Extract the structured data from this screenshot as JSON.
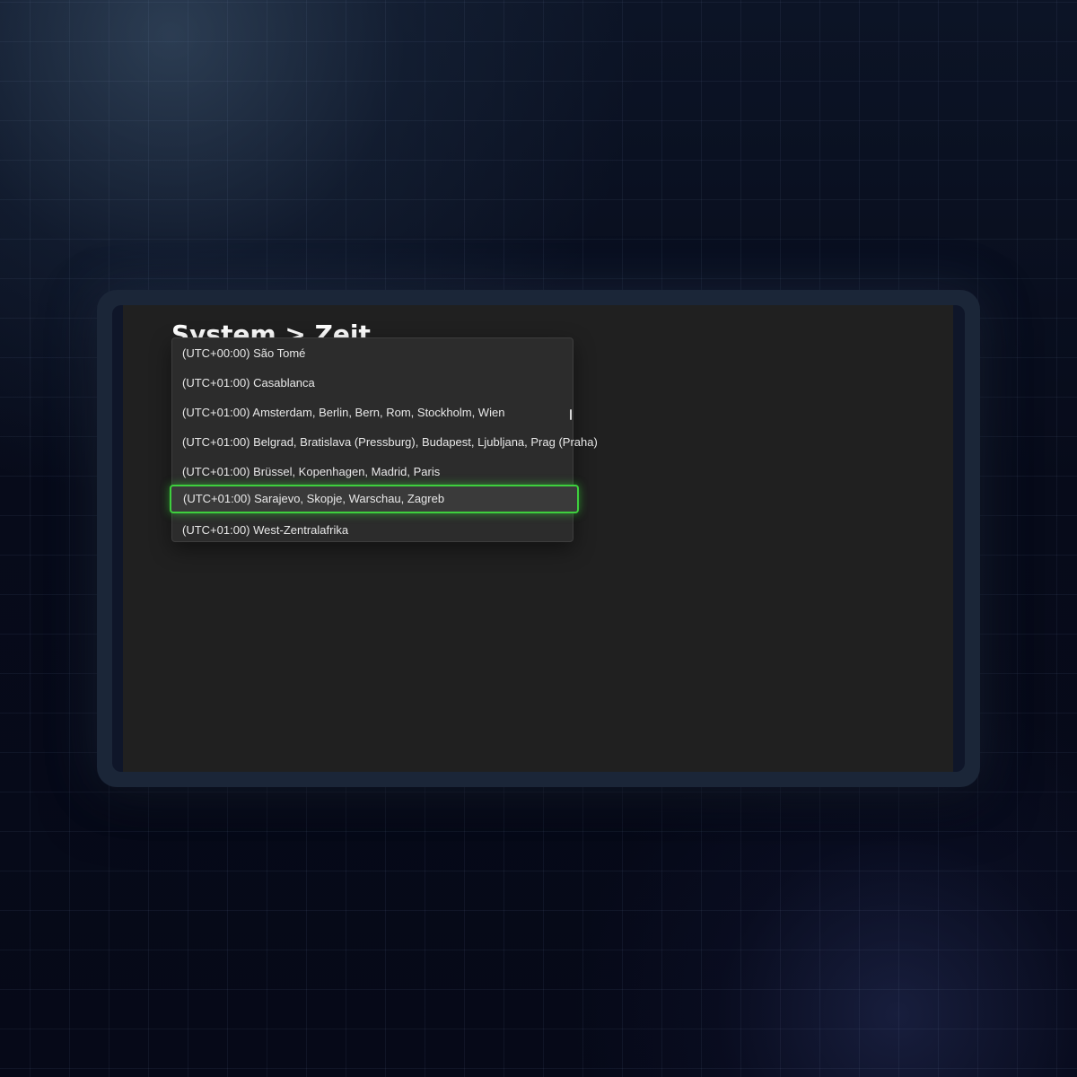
{
  "settings": {
    "page_title": "System > Zeit"
  },
  "timezone_dropdown": {
    "options": [
      "(UTC+00:00) São Tomé",
      "(UTC+01:00) Casablanca",
      "(UTC+01:00) Amsterdam, Berlin, Bern, Rom, Stockholm, Wien",
      "(UTC+01:00) Belgrad, Bratislava (Pressburg), Budapest, Ljubljana, Prag (Praha)",
      "(UTC+01:00) Brüssel, Kopenhagen, Madrid, Paris",
      "(UTC+01:00) Sarajevo, Skopje, Warschau, Zagreb",
      "(UTC+01:00) West-Zentralafrika"
    ],
    "selected_index": 5
  },
  "colors": {
    "selection_outline": "#3ecf3e",
    "screen_background": "#202020",
    "dropdown_background": "#2c2c2c"
  }
}
